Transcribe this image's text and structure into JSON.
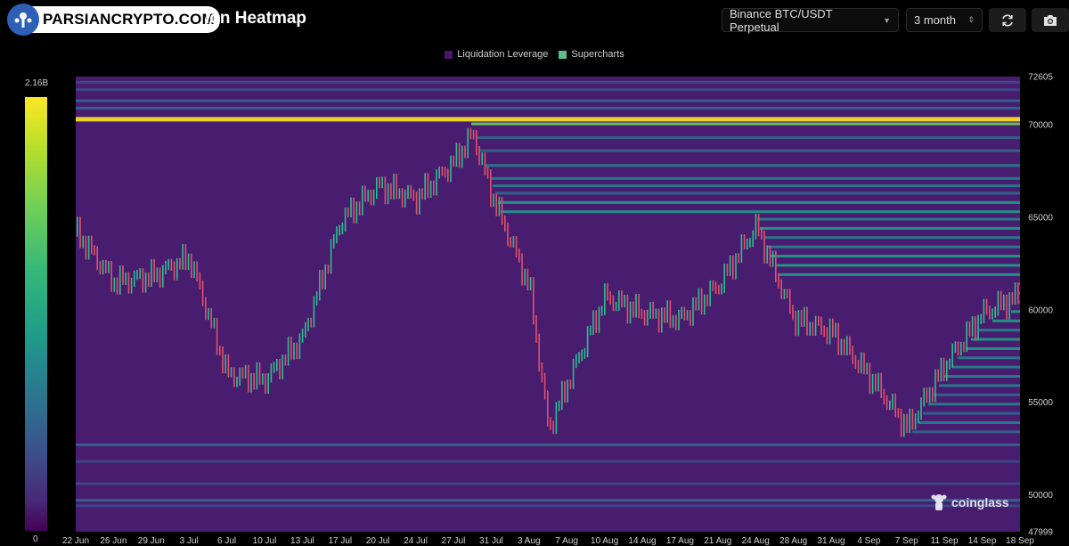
{
  "header": {
    "watermark": "PARSIANCRYPTO.COM",
    "title": "ion Heatmap",
    "pair_select": "Binance BTC/USDT Perpetual",
    "range_select": "3 month",
    "refresh_icon": "refresh-icon",
    "camera_icon": "camera-icon"
  },
  "legend": [
    {
      "label": "Liquidation Leverage",
      "color": "#4a1570"
    },
    {
      "label": "Supercharts",
      "color": "#5fbf87"
    }
  ],
  "colorbar": {
    "max_label": "2.16B",
    "min_label": "0"
  },
  "brand": {
    "label": "coinglass",
    "icon": "coinglass-icon"
  },
  "chart_data": {
    "type": "heatmap",
    "title": "",
    "xlabel": "",
    "ylabel": "",
    "x_ticks": [
      "22 Jun",
      "26 Jun",
      "29 Jun",
      "3 Jul",
      "6 Jul",
      "10 Jul",
      "13 Jul",
      "17 Jul",
      "20 Jul",
      "24 Jul",
      "27 Jul",
      "31 Jul",
      "3 Aug",
      "7 Aug",
      "10 Aug",
      "14 Aug",
      "17 Aug",
      "21 Aug",
      "24 Aug",
      "28 Aug",
      "31 Aug",
      "4 Sep",
      "7 Sep",
      "11 Sep",
      "14 Sep",
      "18 Sep"
    ],
    "y_ticks": [
      72605,
      70000,
      65000,
      60000,
      55000,
      50000,
      47999
    ],
    "ylim": [
      47999,
      72605
    ],
    "background_color": "#481c6e",
    "colorscale": [
      "#440154",
      "#482878",
      "#3e4989",
      "#31688e",
      "#26828e",
      "#1f9e89",
      "#35b779",
      "#6ece58",
      "#b5de2b",
      "#fde725"
    ],
    "price_series": {
      "name": "BTC/USDT",
      "x": [
        "22 Jun",
        "26 Jun",
        "29 Jun",
        "3 Jul",
        "6 Jul",
        "10 Jul",
        "13 Jul",
        "17 Jul",
        "20 Jul",
        "24 Jul",
        "27 Jul",
        "29 Jul",
        "31 Jul",
        "3 Aug",
        "5 Aug",
        "7 Aug",
        "10 Aug",
        "14 Aug",
        "17 Aug",
        "21 Aug",
        "24 Aug",
        "28 Aug",
        "31 Aug",
        "4 Sep",
        "7 Sep",
        "11 Sep",
        "14 Sep",
        "18 Sep",
        "19 Sep"
      ],
      "y": [
        64200,
        61500,
        61800,
        62800,
        56500,
        56200,
        58500,
        64800,
        66700,
        66000,
        68000,
        69500,
        66200,
        61200,
        53500,
        56000,
        60700,
        59800,
        59500,
        61300,
        64500,
        59500,
        58800,
        56400,
        53600,
        57000,
        59800,
        60800,
        63200
      ]
    },
    "bands": [
      {
        "price": 72300,
        "intensity": 0.2
      },
      {
        "price": 71900,
        "intensity": 0.25
      },
      {
        "price": 71300,
        "intensity": 0.3
      },
      {
        "price": 70900,
        "intensity": 0.35
      },
      {
        "price": 70300,
        "intensity": 0.95
      },
      {
        "price": 70050,
        "intensity": 0.75
      },
      {
        "price": 69300,
        "intensity": 0.3
      },
      {
        "price": 68600,
        "intensity": 0.35
      },
      {
        "price": 67800,
        "intensity": 0.4
      },
      {
        "price": 67100,
        "intensity": 0.45
      },
      {
        "price": 66700,
        "intensity": 0.4
      },
      {
        "price": 66300,
        "intensity": 0.3
      },
      {
        "price": 65800,
        "intensity": 0.5
      },
      {
        "price": 65300,
        "intensity": 0.55
      },
      {
        "price": 64900,
        "intensity": 0.45
      },
      {
        "price": 64400,
        "intensity": 0.5
      },
      {
        "price": 63900,
        "intensity": 0.45
      },
      {
        "price": 63400,
        "intensity": 0.4
      },
      {
        "price": 62900,
        "intensity": 0.55
      },
      {
        "price": 62400,
        "intensity": 0.5
      },
      {
        "price": 61900,
        "intensity": 0.6
      },
      {
        "price": 61400,
        "intensity": 0.45
      },
      {
        "price": 60900,
        "intensity": 0.5
      },
      {
        "price": 60400,
        "intensity": 0.45
      },
      {
        "price": 59900,
        "intensity": 0.55
      },
      {
        "price": 59400,
        "intensity": 0.5
      },
      {
        "price": 58900,
        "intensity": 0.45
      },
      {
        "price": 58400,
        "intensity": 0.55
      },
      {
        "price": 57900,
        "intensity": 0.5
      },
      {
        "price": 57400,
        "intensity": 0.45
      },
      {
        "price": 56900,
        "intensity": 0.4
      },
      {
        "price": 56400,
        "intensity": 0.45
      },
      {
        "price": 55900,
        "intensity": 0.4
      },
      {
        "price": 55400,
        "intensity": 0.35
      },
      {
        "price": 54900,
        "intensity": 0.45
      },
      {
        "price": 54400,
        "intensity": 0.35
      },
      {
        "price": 53900,
        "intensity": 0.4
      },
      {
        "price": 53400,
        "intensity": 0.35
      },
      {
        "price": 52700,
        "intensity": 0.3
      },
      {
        "price": 51800,
        "intensity": 0.25
      },
      {
        "price": 50600,
        "intensity": 0.2
      },
      {
        "price": 49700,
        "intensity": 0.3
      },
      {
        "price": 49400,
        "intensity": 0.25
      }
    ]
  }
}
